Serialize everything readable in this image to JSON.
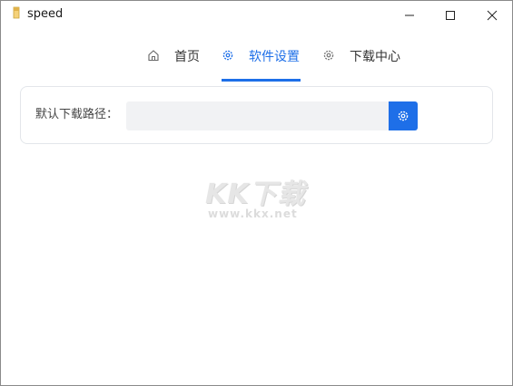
{
  "window": {
    "title": "speed"
  },
  "tabs": [
    {
      "label": "首页",
      "icon": "home-icon",
      "active": false
    },
    {
      "label": "软件设置",
      "icon": "gear-icon",
      "active": true
    },
    {
      "label": "下载中心",
      "icon": "gear-icon",
      "active": false
    }
  ],
  "settings": {
    "download_path_label": "默认下载路径：",
    "download_path_value": "",
    "choose_button_icon": "gear-icon"
  },
  "watermark": {
    "logo_text": "KK下载",
    "url": "www.kkx.net"
  },
  "colors": {
    "accent": "#1e6fe8",
    "input_bg": "#f1f2f4",
    "card_border": "#e3e6ea"
  }
}
